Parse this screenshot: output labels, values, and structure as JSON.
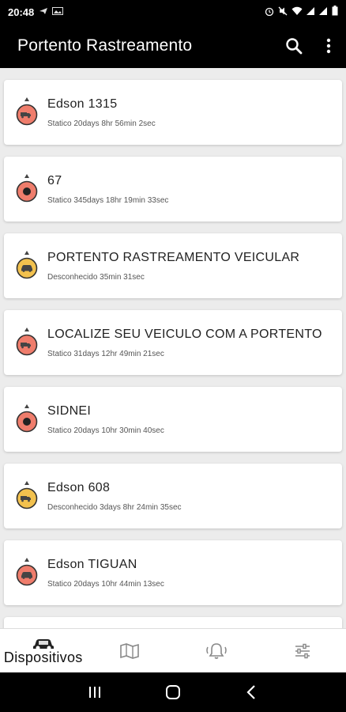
{
  "status_bar": {
    "time": "20:48",
    "left_icons": [
      "navigation-icon",
      "photo-icon"
    ],
    "right_icons": [
      "alarm-icon",
      "mute-icon",
      "wifi-icon",
      "signal-icon",
      "signal-icon",
      "battery-icon"
    ]
  },
  "app_bar": {
    "title": "Portento Rastreamento",
    "search_icon": "search-icon",
    "menu_icon": "more-vert-icon"
  },
  "colors": {
    "red_marker": "#ef7d6c",
    "yellow_marker": "#f2c14e",
    "bar_bg": "#000000"
  },
  "devices": [
    {
      "name": "Edson 1315",
      "status": "Statico 20days 8hr 56min 2sec",
      "icon": "truck-icon",
      "color": "red"
    },
    {
      "name": "67",
      "status": "Statico 345days 18hr 19min 33sec",
      "icon": "dot-icon",
      "color": "red"
    },
    {
      "name": "PORTENTO RASTREAMENTO VEICULAR",
      "status": "Desconhecido 35min 31sec",
      "icon": "car-icon",
      "color": "yellow"
    },
    {
      "name": "LOCALIZE SEU VEICULO COM A PORTENTO",
      "status": "Statico 31days 12hr 49min 21sec",
      "icon": "truck-icon",
      "color": "red"
    },
    {
      "name": "SIDNEI",
      "status": "Statico 20days 10hr 30min 40sec",
      "icon": "dot-icon",
      "color": "red"
    },
    {
      "name": "Edson 608",
      "status": "Desconhecido 3days 8hr 24min 35sec",
      "icon": "truck-icon",
      "color": "yellow"
    },
    {
      "name": "Edson TIGUAN",
      "status": "Statico 20days 10hr 44min 13sec",
      "icon": "car-icon",
      "color": "red"
    },
    {
      "name": "",
      "status": "",
      "icon": "car-icon",
      "color": "red"
    }
  ],
  "bottom_nav": {
    "items": [
      {
        "label": "Dispositivos",
        "icon": "car-icon",
        "active": true
      },
      {
        "label": "",
        "icon": "map-icon",
        "active": false
      },
      {
        "label": "",
        "icon": "bell-ring-icon",
        "active": false
      },
      {
        "label": "",
        "icon": "sliders-icon",
        "active": false
      }
    ]
  }
}
